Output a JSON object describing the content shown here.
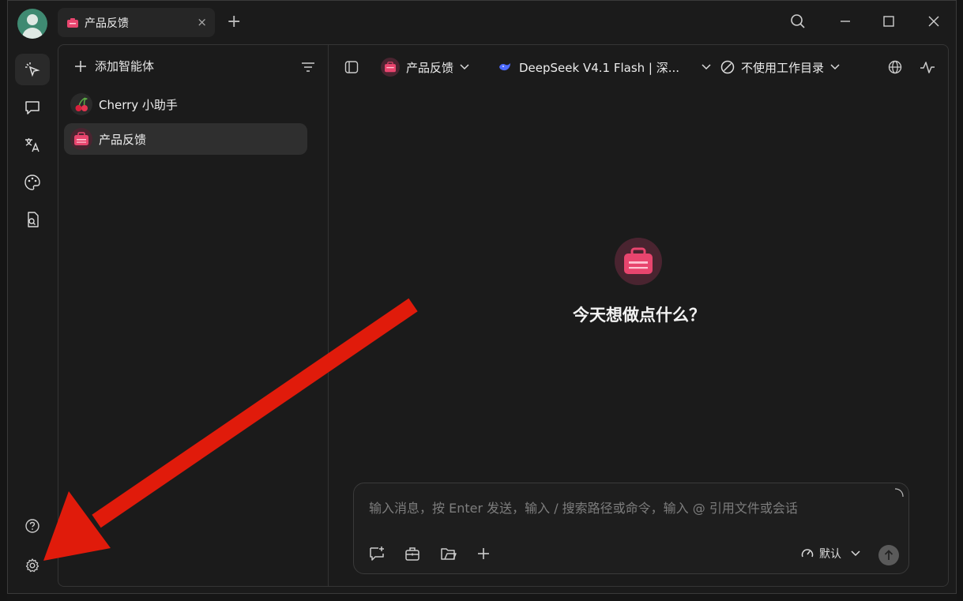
{
  "titlebar": {
    "tab_label": "产品反馈",
    "tab_close": "×",
    "tab_add": "+"
  },
  "sidebar": {
    "add_agent_label": "添加智能体",
    "agents": [
      {
        "name": "Cherry 小助手"
      },
      {
        "name": "产品反馈"
      }
    ]
  },
  "topbar": {
    "agent_name": "产品反馈",
    "model": "DeepSeek V4.1 Flash | 深...",
    "workdir": "不使用工作目录"
  },
  "main": {
    "welcome": "今天想做点什么？"
  },
  "composer": {
    "placeholder": "输入消息，按 Enter 发送，输入 / 搜索路径或命令，输入 @ 引用文件或会话",
    "mode": "默认"
  },
  "colors": {
    "accent_pink": "#e8456e",
    "annotation_red": "#e01b0b",
    "avatar_green": "#3f8a72"
  }
}
